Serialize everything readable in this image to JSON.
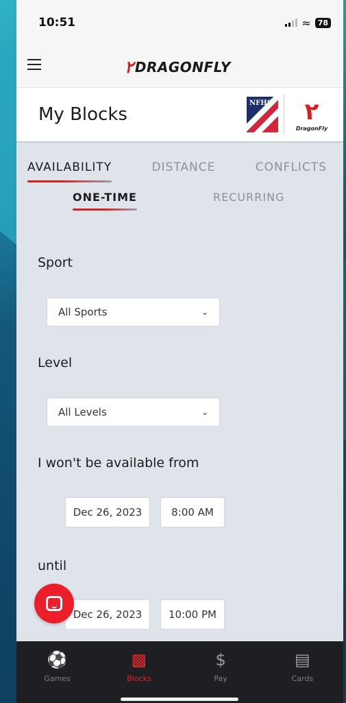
{
  "status": {
    "time": "10:51",
    "battery": "78"
  },
  "app": {
    "brand": "DRAGONFLY",
    "page_title": "My Blocks",
    "nfhs_text": "NFHS",
    "logo_text": "DragonFly"
  },
  "tabs": [
    "AVAILABILITY",
    "DISTANCE",
    "CONFLICTS"
  ],
  "subtabs": [
    "ONE-TIME",
    "RECURRING"
  ],
  "form": {
    "sport_label": "Sport",
    "sport_value": "All Sports",
    "level_label": "Level",
    "level_value": "All Levels",
    "from_label": "I won't be available from",
    "from_date": "Dec 26, 2023",
    "from_time": "8:00 AM",
    "until_label": "until",
    "until_date": "Dec 26, 2023",
    "until_time": "10:00 PM"
  },
  "bottom_nav": [
    {
      "label": "Games",
      "icon": "sports-ball-icon"
    },
    {
      "label": "Blocks",
      "icon": "calendar-icon"
    },
    {
      "label": "Pay",
      "icon": "dollar-icon"
    },
    {
      "label": "Cards",
      "icon": "id-card-icon"
    }
  ],
  "colors": {
    "accent": "#d4201f",
    "active_tab": "#e3262a"
  }
}
